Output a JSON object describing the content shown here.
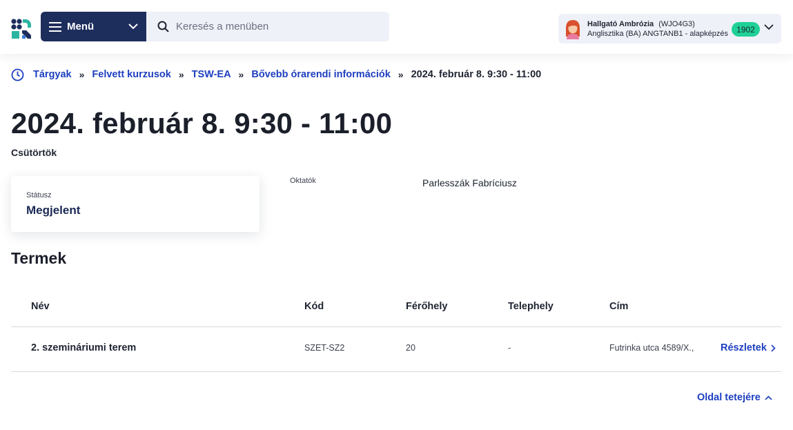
{
  "header": {
    "menu_label": "Menü",
    "search_placeholder": "Keresés a menüben",
    "user": {
      "name": "Hallgató Ambrózia",
      "code": "(WJO4G3)",
      "program": "Anglisztika (BA) ANGTANB1 - alapképzés",
      "badge": "1902"
    }
  },
  "breadcrumb": {
    "items": [
      "Tárgyak",
      "Felvett kurzusok",
      "TSW-EA",
      "Bővebb órarendi információk"
    ],
    "separator": "»",
    "current": "2024. február 8. 9:30 - 11:00"
  },
  "page": {
    "title": "2024. február 8. 9:30 - 11:00",
    "weekday": "Csütörtök",
    "status_label": "Státusz",
    "status_value": "Megjelent",
    "instructors_label": "Oktatók",
    "instructors_value": "Parlesszák Fabríciusz"
  },
  "rooms": {
    "title": "Termek",
    "columns": [
      "Név",
      "Kód",
      "Férőhely",
      "Telephely",
      "Cím"
    ],
    "rows": [
      {
        "name": "2. szemináriumi terem",
        "code": "SZET-SZ2",
        "capacity": "20",
        "site": "-",
        "address": "Futrinka utca 4589/X.,",
        "details": "Részletek"
      }
    ]
  },
  "footer": {
    "to_top": "Oldal tetejére"
  },
  "colors": {
    "brand_navy": "#1d2d5c",
    "link_blue": "#1d3fbf",
    "badge_green": "#1fd196",
    "logo_teal": "#2bb5a0"
  }
}
